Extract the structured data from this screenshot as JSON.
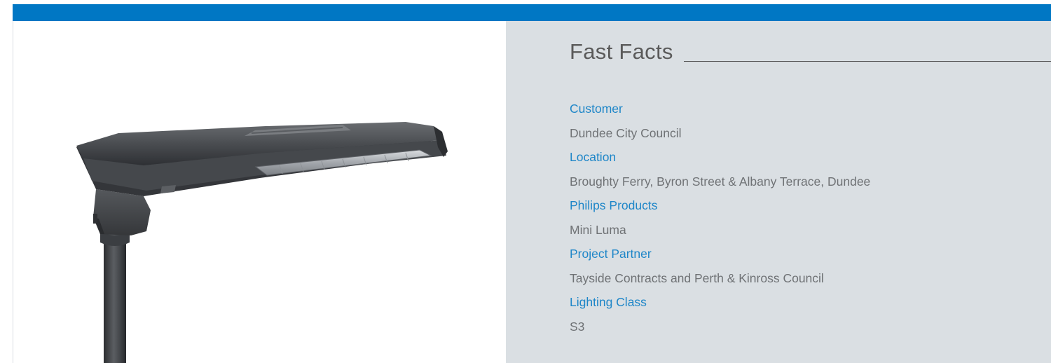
{
  "colors": {
    "brand_bar": "#0077c4",
    "panel_background": "#dadfe3",
    "label_color": "#1e86c8",
    "value_color": "#6f7275"
  },
  "image": {
    "subject": "street-lamp-luminaire"
  },
  "fast_facts": {
    "title": "Fast Facts",
    "items": [
      {
        "label": "Customer",
        "value": "Dundee City Council"
      },
      {
        "label": "Location",
        "value": "Broughty Ferry, Byron Street & Albany Terrace, Dundee"
      },
      {
        "label": "Philips Products",
        "value": "Mini Luma"
      },
      {
        "label": "Project Partner",
        "value": "Tayside Contracts and Perth & Kinross Council"
      },
      {
        "label": "Lighting Class",
        "value": "S3"
      }
    ]
  }
}
